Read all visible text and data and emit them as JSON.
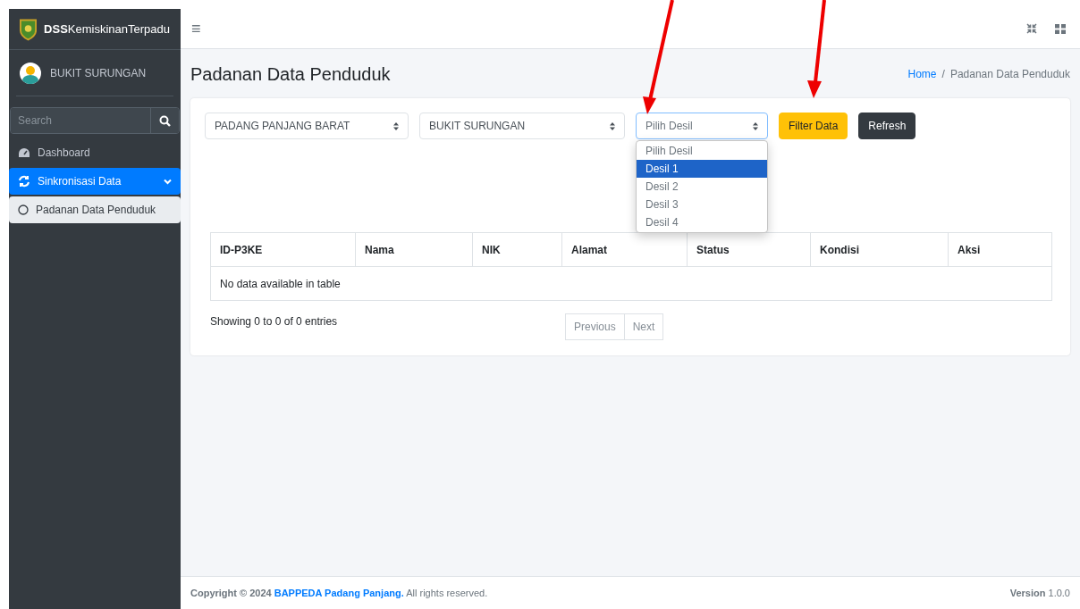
{
  "brand": {
    "bold": "DSS",
    "rest": "KemiskinanTerpadu"
  },
  "user": {
    "name": "BUKIT SURUNGAN"
  },
  "sidebar_search": {
    "placeholder": "Search"
  },
  "sidebar": {
    "items": [
      {
        "label": "Dashboard",
        "selected": false
      },
      {
        "label": "Sinkronisasi Data",
        "selected": true,
        "expanded": true,
        "children": [
          {
            "label": "Padanan Data Penduduk",
            "selected": false
          }
        ]
      }
    ]
  },
  "header": {
    "menu_icon": "≡"
  },
  "page_title": "Padanan Data Penduduk",
  "breadcrumb": [
    {
      "label": "Home",
      "link": true
    },
    {
      "separator": "/",
      "label": "Padanan Data Penduduk",
      "link": false
    }
  ],
  "filters": [
    {
      "value": "PADANG PANJANG BARAT",
      "open": false
    },
    {
      "value": "BUKIT SURUNGAN",
      "open": false
    },
    {
      "value": "Pilih Desil",
      "open": true,
      "options": [
        {
          "label": "Pilih Desil",
          "highlighted": false
        },
        {
          "label": "Desil 1",
          "highlighted": true
        },
        {
          "label": "Desil 2",
          "highlighted": false
        },
        {
          "label": "Desil 3",
          "highlighted": false
        },
        {
          "label": "Desil 4",
          "highlighted": false
        }
      ]
    }
  ],
  "buttons": [
    {
      "label": "Filter Data",
      "kind": "warning"
    },
    {
      "label": "Refresh",
      "kind": "dark"
    }
  ],
  "table": {
    "columns": [
      "ID-P3KE",
      "Nama",
      "NIK",
      "Alamat",
      "Status",
      "Kondisi",
      "Aksi"
    ],
    "empty": "No data available in table"
  },
  "info": "Showing 0 to 0 of 0 entries",
  "pagination": [
    {
      "label": "Previous",
      "disabled": true
    },
    {
      "label": "Next",
      "disabled": true
    }
  ],
  "footer": {
    "prefix": "Copyright © 2024 ",
    "link": "BAPPEDA Padang Panjang.",
    "suffix": " All rights reserved.",
    "version_label": "Version",
    "version": "1.0.0"
  }
}
